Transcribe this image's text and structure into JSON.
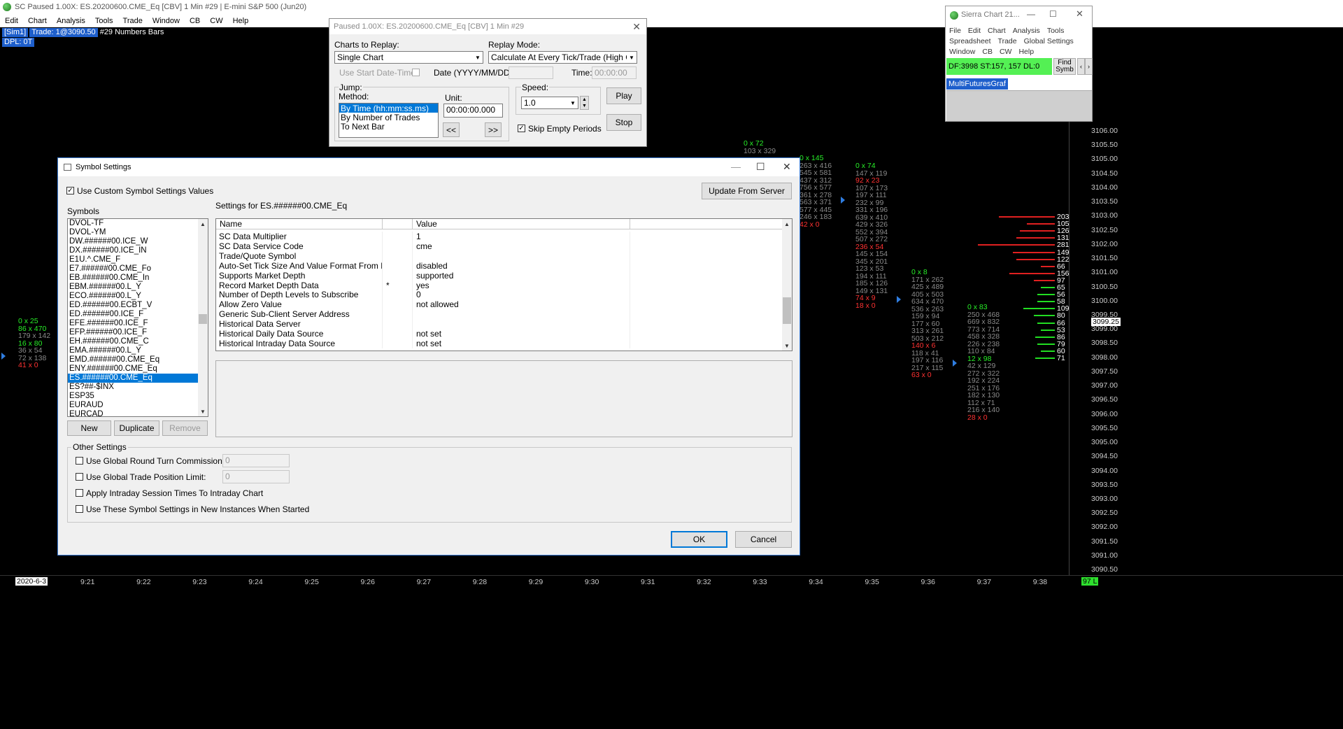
{
  "main_window": {
    "title": "SC Paused 1.00X: ES.20200600.CME_Eq [CBV]  1 Min  #29 | E-mini S&P 500 (Jun20)",
    "menu": [
      "Edit",
      "Chart",
      "Analysis",
      "Tools",
      "Trade",
      "Window",
      "CB",
      "CW",
      "Help"
    ],
    "info_sim": "[Sim1]",
    "info_trade": "Trade: 1@3090.50",
    "info_bars": "#29 Numbers Bars",
    "info_dpl": "DPL: 0T"
  },
  "price_axis": {
    "labels": [
      "3106.00",
      "3105.50",
      "3105.00",
      "3104.50",
      "3104.00",
      "3103.50",
      "3103.00",
      "3102.50",
      "3102.00",
      "3101.50",
      "3101.00",
      "3100.50",
      "3100.00",
      "3099.50",
      "3099.00",
      "3098.50",
      "3098.00",
      "3097.50",
      "3097.00",
      "3096.50",
      "3096.00",
      "3095.50",
      "3095.00",
      "3094.50",
      "3094.00",
      "3093.50",
      "3093.00",
      "3092.50",
      "3092.00",
      "3091.50",
      "3091.00",
      "3090.50"
    ],
    "current_price": "3099.25"
  },
  "time_axis": {
    "date": "2020-6-3",
    "labels": [
      "9:21",
      "9:22",
      "9:23",
      "9:24",
      "9:25",
      "9:26",
      "9:27",
      "9:28",
      "9:29",
      "9:30",
      "9:31",
      "9:32",
      "9:33",
      "9:34",
      "9:35",
      "9:36",
      "9:37",
      "9:38"
    ],
    "last": "97 L"
  },
  "dom": {
    "values": [
      "203",
      "105",
      "126",
      "131",
      "281",
      "149",
      "122",
      "66",
      "156",
      "97",
      "65",
      "56",
      "58",
      "109",
      "80",
      "66",
      "53",
      "86",
      "79",
      "60",
      "71"
    ]
  },
  "footprints": {
    "col_921": [
      {
        "t": "0 x 25",
        "c": "gr"
      },
      {
        "t": "86 x 470",
        "c": "gr"
      },
      {
        "t": "179 x 142",
        "c": "g"
      },
      {
        "t": "16 x 80",
        "c": "gr"
      },
      {
        "t": "36 x 54",
        "c": "g"
      },
      {
        "t": "72 x 138",
        "c": "g"
      },
      {
        "t": "41 x 0",
        "c": "rd"
      }
    ],
    "col_933": [
      {
        "t": "0 x 72",
        "c": "gr"
      },
      {
        "t": "103 x 329",
        "c": "g"
      }
    ],
    "col_934": [
      {
        "t": "0 x 145",
        "c": "gr"
      },
      {
        "t": "263 x 416",
        "c": "g"
      },
      {
        "t": "545 x 581",
        "c": "g"
      },
      {
        "t": "437 x 312",
        "c": "g"
      },
      {
        "t": "756 x 577",
        "c": "g"
      },
      {
        "t": "361 x 278",
        "c": "g"
      },
      {
        "t": "563 x 371",
        "c": "g"
      },
      {
        "t": "577 x 445",
        "c": "g"
      },
      {
        "t": "246 x 183",
        "c": "g"
      },
      {
        "t": "42 x 0",
        "c": "rd"
      }
    ],
    "col_935": [
      {
        "t": "0 x 74",
        "c": "gr"
      },
      {
        "t": "147 x 119",
        "c": "g"
      },
      {
        "t": "92 x 23",
        "c": "rd"
      },
      {
        "t": "107 x 173",
        "c": "g"
      },
      {
        "t": "197 x 111",
        "c": "g"
      },
      {
        "t": "232 x 99",
        "c": "g"
      },
      {
        "t": "331 x 196",
        "c": "g"
      },
      {
        "t": "639 x 410",
        "c": "g"
      },
      {
        "t": "429 x 326",
        "c": "g"
      },
      {
        "t": "552 x 394",
        "c": "g"
      },
      {
        "t": "507 x 272",
        "c": "g"
      },
      {
        "t": "236 x 54",
        "c": "rd"
      },
      {
        "t": "145 x 154",
        "c": "g"
      },
      {
        "t": "345 x 201",
        "c": "g"
      },
      {
        "t": "123 x 53",
        "c": "g"
      },
      {
        "t": "194 x 111",
        "c": "g"
      },
      {
        "t": "185 x 126",
        "c": "g"
      },
      {
        "t": "149 x 131",
        "c": "g"
      },
      {
        "t": "74 x 9",
        "c": "rd"
      },
      {
        "t": "18 x 0",
        "c": "rd"
      }
    ],
    "col_936": [
      {
        "t": "0 x 8",
        "c": "gr"
      },
      {
        "t": "171 x 262",
        "c": "g"
      },
      {
        "t": "425 x 489",
        "c": "g"
      },
      {
        "t": "405 x 503",
        "c": "g"
      },
      {
        "t": "634 x 470",
        "c": "g"
      },
      {
        "t": "536 x 263",
        "c": "g"
      },
      {
        "t": "159 x 94",
        "c": "g"
      },
      {
        "t": "177 x 60",
        "c": "g"
      },
      {
        "t": "313 x 261",
        "c": "g"
      },
      {
        "t": "503 x 212",
        "c": "g"
      },
      {
        "t": "140 x 6",
        "c": "rd"
      },
      {
        "t": "118 x 41",
        "c": "g"
      },
      {
        "t": "197 x 116",
        "c": "g"
      },
      {
        "t": "217 x 115",
        "c": "g"
      },
      {
        "t": "63 x 0",
        "c": "rd"
      }
    ],
    "col_937": [
      {
        "t": "0 x 83",
        "c": "gr"
      },
      {
        "t": "250 x 468",
        "c": "g"
      },
      {
        "t": "669 x 832",
        "c": "g"
      },
      {
        "t": "773 x 714",
        "c": "g"
      },
      {
        "t": "458 x 328",
        "c": "g"
      },
      {
        "t": "226 x 238",
        "c": "g"
      },
      {
        "t": "110 x 84",
        "c": "g"
      },
      {
        "t": "12 x 98",
        "c": "gr"
      },
      {
        "t": "42 x 129",
        "c": "g"
      },
      {
        "t": "272 x 322",
        "c": "g"
      },
      {
        "t": "192 x 224",
        "c": "g"
      },
      {
        "t": "251 x 176",
        "c": "g"
      },
      {
        "t": "182 x 130",
        "c": "g"
      },
      {
        "t": "112 x 71",
        "c": "g"
      },
      {
        "t": "216 x 140",
        "c": "g"
      },
      {
        "t": "28 x 0",
        "c": "rd"
      }
    ]
  },
  "replay": {
    "title": "Paused 1.00X: ES.20200600.CME_Eq [CBV]  1 Min  #29",
    "charts_label": "Charts to Replay:",
    "charts_value": "Single Chart",
    "mode_label": "Replay Mode:",
    "mode_value": "Calculate At Every Tick/Trade (High CPU",
    "use_start_label": "Use Start Date-Time",
    "date_label": "Date (YYYY/MM/DD):",
    "date_value": "",
    "time_label": "Time:",
    "time_value": "00:00:00",
    "jump_label": "Jump:",
    "method_label": "Method:",
    "methods": [
      "By Time (hh:mm:ss.ms)",
      "By Number of Trades",
      "To Next Bar"
    ],
    "unit_label": "Unit:",
    "unit_value": "00:00:00.000",
    "back_label": "<<",
    "fwd_label": ">>",
    "speed_label": "Speed:",
    "speed_value": "1.0",
    "skip_label": "Skip Empty Periods",
    "play_label": "Play",
    "stop_label": "Stop"
  },
  "sc_window": {
    "title": "Sierra Chart 21...",
    "menu_row1": [
      "File",
      "Edit",
      "Chart",
      "Analysis",
      "Tools"
    ],
    "menu_row2": [
      "Spreadsheet",
      "Trade",
      "Global Settings"
    ],
    "menu_row3": [
      "Window",
      "CB",
      "CW",
      "Help"
    ],
    "status": "DF:3998  ST:157, 157  DL:0",
    "find_label": "Find Symb",
    "tab_label": "MultiFuturesGraf"
  },
  "symbol_settings": {
    "title": "Symbol Settings",
    "use_custom_label": "Use Custom Symbol Settings Values",
    "update_label": "Update From Server",
    "symbols_label": "Symbols",
    "settings_for": "Settings for ES.######00.CME_Eq",
    "symbols": [
      "DVOL-TF",
      "DVOL-YM",
      "DW.######00.ICE_W",
      "DX.######00.ICE_IN",
      "E1U.^.CME_F",
      "E7.######00.CME_Fo",
      "EB.######00.CME_In",
      "EBM.######00.L_Y",
      "ECO.######00.L_Y",
      "ED.######00.ECBT_V",
      "ED.######00.ICE_F",
      "EFE.######00.ICE_F",
      "EFP.######00.ICE_F",
      "EH.######00.CME_C",
      "EMA.######00.L_Y",
      "EMD.######00.CME_Eq",
      "ENY.######00.CME_Eq",
      "ES.######00.CME_Eq",
      "ES?##-$INX",
      "ESP35",
      "EURAUD",
      "EURCAD"
    ],
    "selected_symbol": "ES.######00.CME_Eq",
    "grid_headers": [
      "Name",
      "",
      "Value"
    ],
    "rows": [
      {
        "name": "SC Data Multiplier",
        "flag": "",
        "value": "1"
      },
      {
        "name": "SC Data Service Code",
        "flag": "",
        "value": "cme"
      },
      {
        "name": "Trade/Quote Symbol",
        "flag": "",
        "value": ""
      },
      {
        "name": "Auto-Set Tick Size And Value Format From Da...",
        "flag": "",
        "value": "disabled"
      },
      {
        "name": "Supports Market Depth",
        "flag": "",
        "value": "supported"
      },
      {
        "name": "Record Market Depth Data",
        "flag": "*",
        "value": "yes"
      },
      {
        "name": "Number of Depth Levels to Subscribe",
        "flag": "",
        "value": "0"
      },
      {
        "name": "Allow Zero Value",
        "flag": "",
        "value": "not allowed"
      },
      {
        "name": "Generic Sub-Client Server Address",
        "flag": "",
        "value": ""
      },
      {
        "name": "Historical Data Server",
        "flag": "",
        "value": ""
      },
      {
        "name": "Historical Daily Data Source",
        "flag": "",
        "value": "not set"
      },
      {
        "name": "Historical Intraday Data Source",
        "flag": "",
        "value": "not set"
      }
    ],
    "new_label": "New",
    "duplicate_label": "Duplicate",
    "remove_label": "Remove",
    "other_label": "Other Settings",
    "opt1": "Use Global Round Turn Commission:",
    "opt1_value": "0",
    "opt2": "Use Global Trade Position Limit:",
    "opt2_value": "0",
    "opt3": "Apply Intraday Session Times To Intraday Chart",
    "opt4": "Use These Symbol Settings in New Instances When Started",
    "ok_label": "OK",
    "cancel_label": "Cancel"
  }
}
